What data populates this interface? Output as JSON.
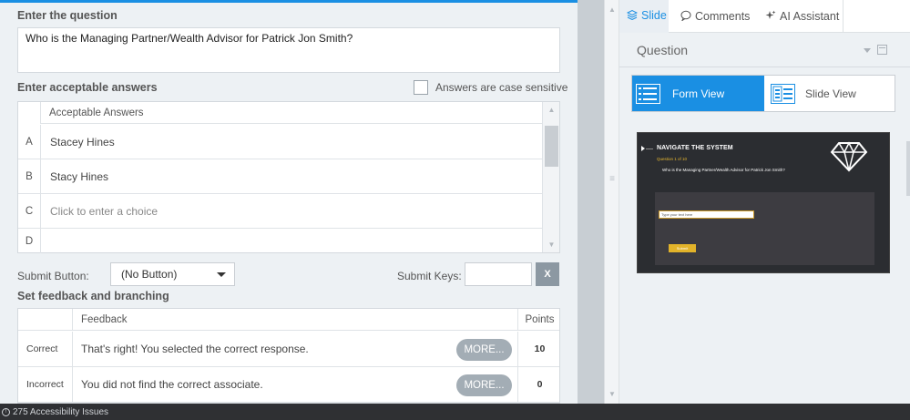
{
  "form": {
    "question_label": "Enter the question",
    "question_text": "Who is the Managing Partner/Wealth Advisor for Patrick Jon Smith?",
    "answers_label": "Enter acceptable answers",
    "case_sensitive_label": "Answers are case sensitive",
    "answers_column": "Acceptable Answers",
    "answers": [
      {
        "letter": "A",
        "text": "Stacey Hines"
      },
      {
        "letter": "B",
        "text": "Stacy Hines"
      },
      {
        "letter": "C",
        "text": "Click to enter a choice"
      },
      {
        "letter": "D",
        "text": ""
      }
    ],
    "submit_button_label": "Submit Button:",
    "submit_button_value": "(No Button)",
    "submit_keys_label": "Submit Keys:",
    "clear_keys_label": "X",
    "feedback_section_label": "Set feedback and branching",
    "feedback_column": "Feedback",
    "points_column": "Points",
    "feedback_rows": [
      {
        "type": "Correct",
        "text": "That's right! You selected the correct response.",
        "more": "MORE...",
        "points": "10"
      },
      {
        "type": "Incorrect",
        "text": "You did not find the correct associate.",
        "more": "MORE...",
        "points": "0"
      }
    ]
  },
  "panel": {
    "tabs": [
      {
        "label": "Slide",
        "icon": "slide-layers-icon"
      },
      {
        "label": "Comments",
        "icon": "comment-bubble-icon"
      },
      {
        "label": "AI Assistant",
        "icon": "sparkle-icon"
      }
    ],
    "section_title": "Question",
    "form_view_label": "Form View",
    "slide_view_label": "Slide View",
    "preview": {
      "title": "NAVIGATE THE SYSTEM",
      "question_number": "Question 1 of 10",
      "question_text": "Who is the Managing Partner/Wealth Advisor for Patrick Jon Smith?",
      "input_placeholder": "Type your text here",
      "submit_label": "Submit"
    }
  },
  "status": {
    "accessibility_issues": "275 Accessibility Issues"
  },
  "colors": {
    "accent": "#1a8fe3",
    "preview_bg": "#2b2d31",
    "preview_highlight": "#e2b32a"
  }
}
